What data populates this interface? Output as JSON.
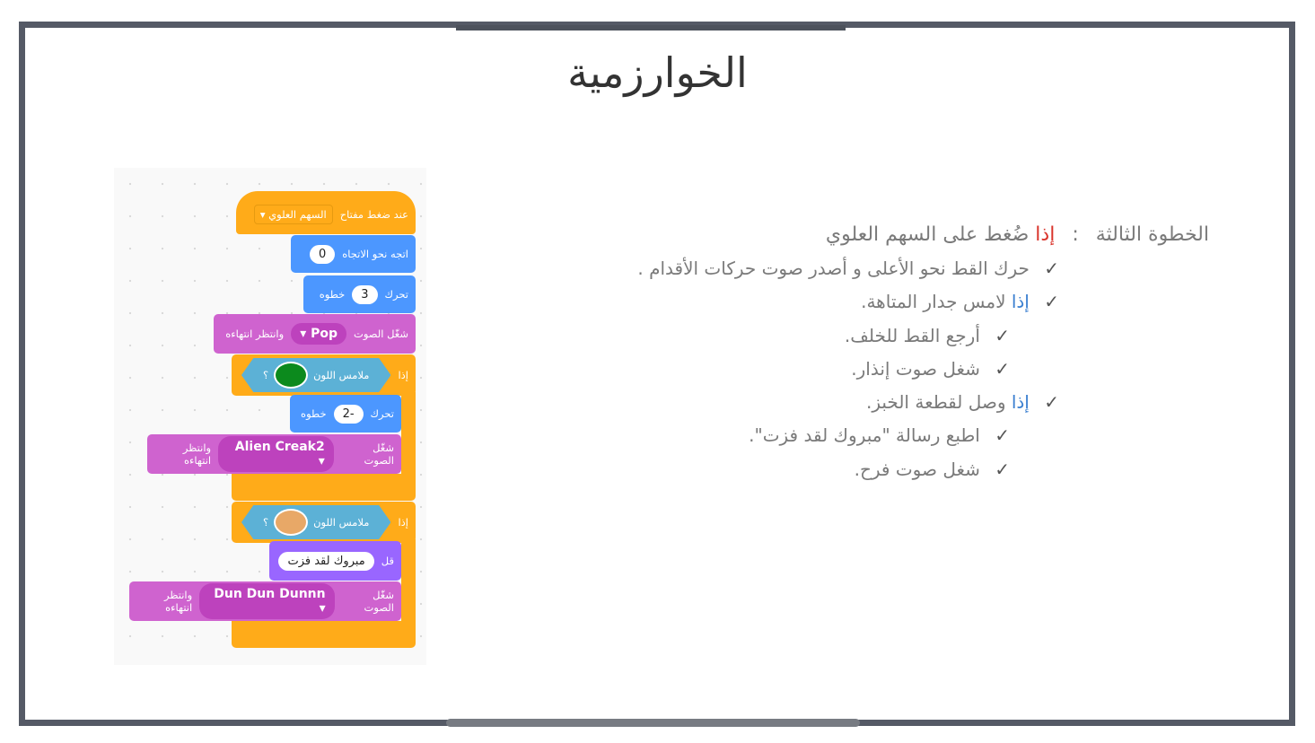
{
  "slide": {
    "title": "الخوارزمية"
  },
  "blocks": {
    "hat": {
      "label": "عند ضغط مفتاح",
      "key": "السهم العلوي"
    },
    "point": {
      "label": "اتجه نحو الاتجاه",
      "value": "0"
    },
    "move1": {
      "label": "تحرك",
      "value": "3",
      "unit": "خطوه"
    },
    "sound1": {
      "label": "شغّل الصوت",
      "sound": "Pop",
      "wait": "وانتظر انتهاءه"
    },
    "if1": {
      "label": "إذا",
      "sense": "ملامس اللون",
      "q": "؟",
      "color": "#0c8a1d"
    },
    "move2": {
      "label": "تحرك",
      "value": "-2",
      "unit": "خطوه"
    },
    "sound2": {
      "label": "شغّل الصوت",
      "sound": "Alien Creak2",
      "wait": "وانتظر انتهاءه"
    },
    "if2": {
      "label": "إذا",
      "sense": "ملامس اللون",
      "q": "؟",
      "color": "#e8a867"
    },
    "say": {
      "label": "قل",
      "text": "مبروك لقد فزت"
    },
    "sound3": {
      "label": "شغّل الصوت",
      "sound": "Dun Dun Dunnn",
      "wait": "وانتظر انتهاءه"
    }
  },
  "algorithm": {
    "step_label": "الخطوة الثالثة",
    "colon": ":",
    "if_word": "إذا",
    "step_rest": "ضُغط على السهم العلوي",
    "check": "✓",
    "lines": [
      {
        "text": "حرك القط نحو الأعلى و أصدر صوت حركات الأقدام ."
      },
      {
        "if": "إذا",
        "text": "لامس جدار المتاهة."
      },
      {
        "text": "أرجع القط للخلف."
      },
      {
        "text": "شغل صوت إنذار."
      },
      {
        "if": "إذا",
        "text": "وصل لقطعة الخبز."
      },
      {
        "text": "اطبع رسالة \"مبروك لقد فزت\"."
      },
      {
        "text": "شغل صوت فرح."
      }
    ]
  }
}
